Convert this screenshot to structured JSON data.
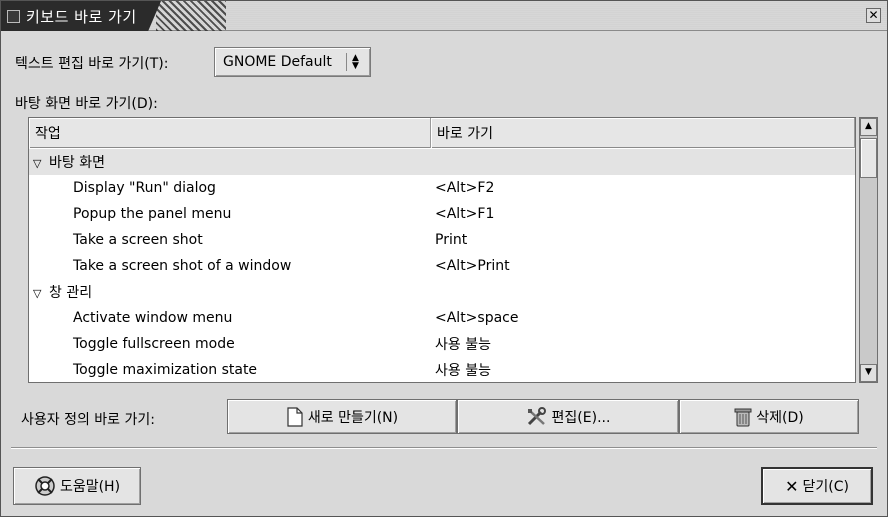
{
  "window": {
    "title": "키보드 바로 가기"
  },
  "text_edit": {
    "label": "텍스트 편집 바로 가기(T):",
    "value": "GNOME Default"
  },
  "desktop_shortcuts": {
    "label": "바탕 화면 바로 가기(D):"
  },
  "tree": {
    "columns": [
      "작업",
      "바로 가기"
    ],
    "rows": [
      {
        "type": "group",
        "expander": "▽",
        "action": "바탕 화면",
        "shortcut": ""
      },
      {
        "type": "item",
        "action": "Display \"Run\" dialog",
        "shortcut": "<Alt>F2"
      },
      {
        "type": "item",
        "action": "Popup the panel menu",
        "shortcut": "<Alt>F1"
      },
      {
        "type": "item",
        "action": "Take a screen shot",
        "shortcut": "Print"
      },
      {
        "type": "item",
        "action": "Take a screen shot of a window",
        "shortcut": "<Alt>Print"
      },
      {
        "type": "group2",
        "expander": "▽",
        "action": "창 관리",
        "shortcut": ""
      },
      {
        "type": "item",
        "action": "Activate window menu",
        "shortcut": "<Alt>space"
      },
      {
        "type": "item",
        "action": "Toggle fullscreen mode",
        "shortcut": "사용 불능"
      },
      {
        "type": "item",
        "action": "Toggle maximization state",
        "shortcut": "사용 불능"
      }
    ]
  },
  "custom": {
    "label": "사용자 정의 바로 가기:",
    "new_label": "새로 만들기(N)",
    "edit_label": "편집(E)...",
    "delete_label": "삭제(D)"
  },
  "footer": {
    "help_label": "도움말(H)",
    "close_label": "닫기(C)"
  },
  "icons": {
    "new": "new-document-icon",
    "edit": "tools-icon",
    "delete": "trash-icon",
    "help": "help-lifebuoy-icon",
    "close": "close-x-icon"
  }
}
